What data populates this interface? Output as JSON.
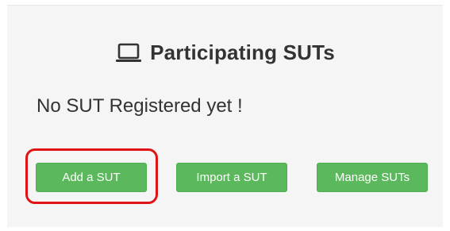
{
  "panel": {
    "title": "Participating SUTs",
    "title_icon": "laptop-icon",
    "empty_message": "No SUT Registered yet !"
  },
  "actions": {
    "add_label": "Add a SUT",
    "import_label": "Import a SUT",
    "manage_label": "Manage SUTs"
  },
  "colors": {
    "button_green": "#5cb85c",
    "highlight_red": "#e01414",
    "panel_bg": "#f5f5f5",
    "text": "#333333"
  }
}
